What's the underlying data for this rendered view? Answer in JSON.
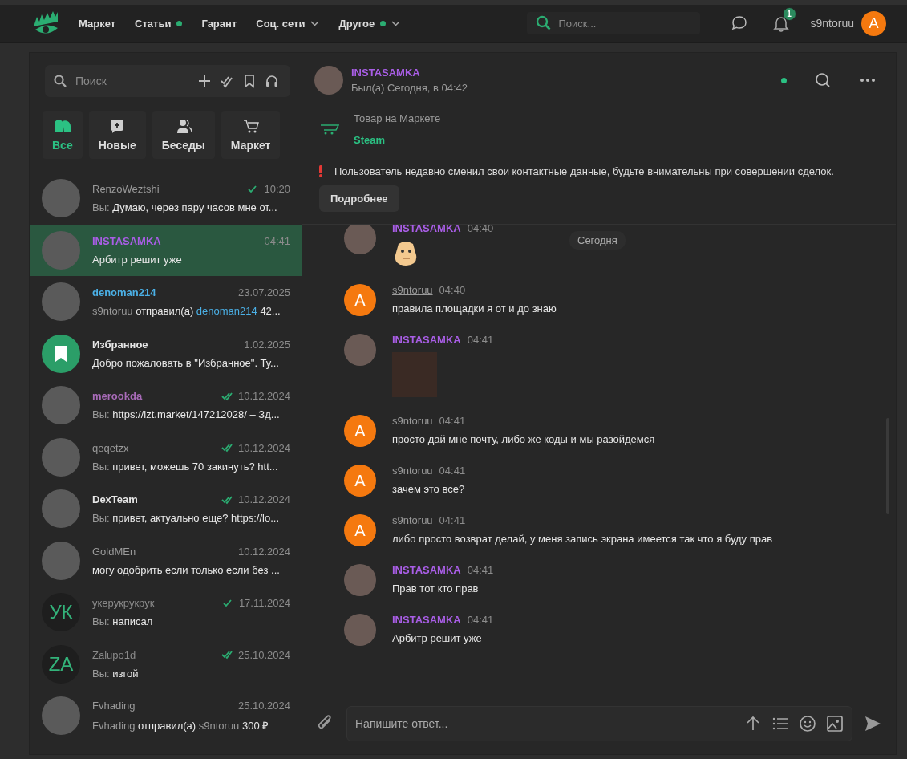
{
  "topbar": {
    "nav": [
      {
        "label": "Маркет",
        "dot": false,
        "dropdown": false
      },
      {
        "label": "Статьи",
        "dot": true,
        "dropdown": false
      },
      {
        "label": "Гарант",
        "dot": false,
        "dropdown": false
      },
      {
        "label": "Соц. сети",
        "dot": false,
        "dropdown": true
      },
      {
        "label": "Другое",
        "dot": true,
        "dropdown": true
      }
    ],
    "search": {
      "placeholder": "Поиск..."
    },
    "notifications": {
      "badge": "1"
    },
    "user": {
      "name": "s9ntoruu",
      "avatar": "A"
    }
  },
  "sidebar": {
    "search": {
      "placeholder": "Поиск"
    },
    "folders": [
      {
        "label": "Все",
        "kind": "all",
        "selected": true
      },
      {
        "label": "Новые",
        "kind": "new",
        "selected": false
      },
      {
        "label": "Беседы",
        "kind": "groups",
        "selected": false
      },
      {
        "label": "Маркет",
        "kind": "market",
        "selected": false
      }
    ],
    "chats": [
      {
        "name": "RenzoWeztshi",
        "color": "#9a9a9a",
        "avatar": {
          "kind": "photo"
        },
        "strikethrough": false,
        "bold": false,
        "receipt": {
          "kind": "sent"
        },
        "time": "10:20",
        "selected": false,
        "preview": [
          {
            "text": "Вы: ",
            "kind": "muted"
          },
          {
            "text": "Думаю, через пару часов мне от...",
            "kind": "plain"
          }
        ]
      },
      {
        "name": "INSTASAMKA",
        "color": "#a95ee6",
        "avatar": {
          "kind": "photo"
        },
        "strikethrough": false,
        "bold": true,
        "time": "04:41",
        "selected": true,
        "preview": [
          {
            "text": "Арбитр решит уже",
            "kind": "plain"
          }
        ]
      },
      {
        "name": "denoman214",
        "color": "#4bb0e6",
        "avatar": {
          "kind": "photo"
        },
        "strikethrough": false,
        "bold": true,
        "time": "23.07.2025",
        "selected": false,
        "preview": [
          {
            "text": "s9ntoruu",
            "kind": "muted"
          },
          {
            "text": " отправил(а) ",
            "kind": "plain"
          },
          {
            "text": "denoman214",
            "kind": "link"
          },
          {
            "text": " 42...",
            "kind": "plain"
          }
        ]
      },
      {
        "name": "Избранное",
        "color": "#e6e6e6",
        "avatar": {
          "kind": "saved"
        },
        "strikethrough": false,
        "bold": true,
        "time": "1.02.2025",
        "selected": false,
        "preview": [
          {
            "text": "Добро пожаловать в \"Избранное\". Ту...",
            "kind": "plain"
          }
        ]
      },
      {
        "name": "merookda",
        "color": "#a86bb8",
        "avatar": {
          "kind": "photo"
        },
        "strikethrough": false,
        "bold": true,
        "receipt": {
          "kind": "read"
        },
        "time": "10.12.2024",
        "selected": false,
        "preview": [
          {
            "text": "Вы: ",
            "kind": "muted"
          },
          {
            "text": "https://lzt.market/147212028/ – Зд...",
            "kind": "plain"
          }
        ]
      },
      {
        "name": "qeqetzx",
        "color": "#9a9a9a",
        "avatar": {
          "kind": "photo"
        },
        "strikethrough": false,
        "bold": false,
        "receipt": {
          "kind": "read"
        },
        "time": "10.12.2024",
        "selected": false,
        "preview": [
          {
            "text": "Вы: ",
            "kind": "muted"
          },
          {
            "text": "привет, можешь 70 закинуть? htt...",
            "kind": "plain"
          }
        ]
      },
      {
        "name": "DexTeam",
        "color": "#e6e6e6",
        "avatar": {
          "kind": "photo"
        },
        "strikethrough": false,
        "bold": true,
        "receipt": {
          "kind": "read"
        },
        "time": "10.12.2024",
        "selected": false,
        "preview": [
          {
            "text": "Вы: ",
            "kind": "muted"
          },
          {
            "text": "привет, актуально еще? https://lo...",
            "kind": "plain"
          }
        ]
      },
      {
        "name": "GoldMEn",
        "color": "#9a9a9a",
        "avatar": {
          "kind": "photo"
        },
        "strikethrough": false,
        "bold": false,
        "time": "10.12.2024",
        "selected": false,
        "preview": [
          {
            "text": "могу одобрить если только если без ...",
            "kind": "plain"
          }
        ]
      },
      {
        "name": "укерукрукрук",
        "color": "#8a8a8a",
        "avatar": {
          "kind": "initials",
          "text": "УК"
        },
        "strikethrough": true,
        "bold": false,
        "receipt": {
          "kind": "sent"
        },
        "time": "17.11.2024",
        "selected": false,
        "preview": [
          {
            "text": "Вы: ",
            "kind": "muted"
          },
          {
            "text": "написал",
            "kind": "plain"
          }
        ]
      },
      {
        "name": "Zalupo1d",
        "color": "#8a8a8a",
        "avatar": {
          "kind": "initials",
          "text": "ZA"
        },
        "strikethrough": true,
        "bold": false,
        "receipt": {
          "kind": "read"
        },
        "time": "25.10.2024",
        "selected": false,
        "preview": [
          {
            "text": "Вы: ",
            "kind": "muted"
          },
          {
            "text": "изгой",
            "kind": "plain"
          }
        ]
      },
      {
        "name": "Fvhading",
        "color": "#9a9a9a",
        "avatar": {
          "kind": "photo"
        },
        "strikethrough": false,
        "bold": false,
        "time": "25.10.2024",
        "selected": false,
        "preview": [
          {
            "text": "Fvhading",
            "kind": "muted"
          },
          {
            "text": " отправил(а) ",
            "kind": "plain"
          },
          {
            "text": "s9ntoruu",
            "kind": "muted"
          },
          {
            "text": " 300 ₽",
            "kind": "plain"
          }
        ]
      }
    ]
  },
  "chat": {
    "header": {
      "name": "INSTASAMKA",
      "status": "Был(а) Сегодня, в 04:42",
      "online": true
    },
    "product": {
      "label": "Товар на Маркете",
      "title": "Steam"
    },
    "warning": {
      "text": "Пользователь недавно сменил свои контактные данные, будьте внимательны при совершении сделок.",
      "button": "Подробнее"
    },
    "date_chip": "Сегодня",
    "messages": [
      {
        "author": "INSTASAMKA",
        "mine": false,
        "time": "04:40",
        "kind": "sticker",
        "hovered": false
      },
      {
        "author": "s9ntoruu",
        "mine": true,
        "avatar": "A",
        "time": "04:40",
        "kind": "text",
        "text": "правила площадки я от и до знаю",
        "hovered": true
      },
      {
        "author": "INSTASAMKA",
        "mine": false,
        "time": "04:41",
        "kind": "image",
        "hovered": false
      },
      {
        "author": "s9ntoruu",
        "mine": true,
        "avatar": "A",
        "time": "04:41",
        "kind": "text",
        "text": "просто дай мне почту, либо же коды и мы разойдемся",
        "hovered": false
      },
      {
        "author": "s9ntoruu",
        "mine": true,
        "avatar": "A",
        "time": "04:41",
        "kind": "text",
        "text": "зачем это все?",
        "hovered": false
      },
      {
        "author": "s9ntoruu",
        "mine": true,
        "avatar": "A",
        "time": "04:41",
        "kind": "text",
        "text": "либо просто возврат делай, у меня запись экрана имеется так что я буду прав",
        "hovered": false
      },
      {
        "author": "INSTASAMKA",
        "mine": false,
        "time": "04:41",
        "kind": "text",
        "text": "Прав тот кто прав",
        "hovered": false
      },
      {
        "author": "INSTASAMKA",
        "mine": false,
        "time": "04:41",
        "kind": "text",
        "text": "Арбитр решит уже",
        "hovered": false
      }
    ],
    "composer": {
      "placeholder": "Напишите ответ..."
    }
  }
}
